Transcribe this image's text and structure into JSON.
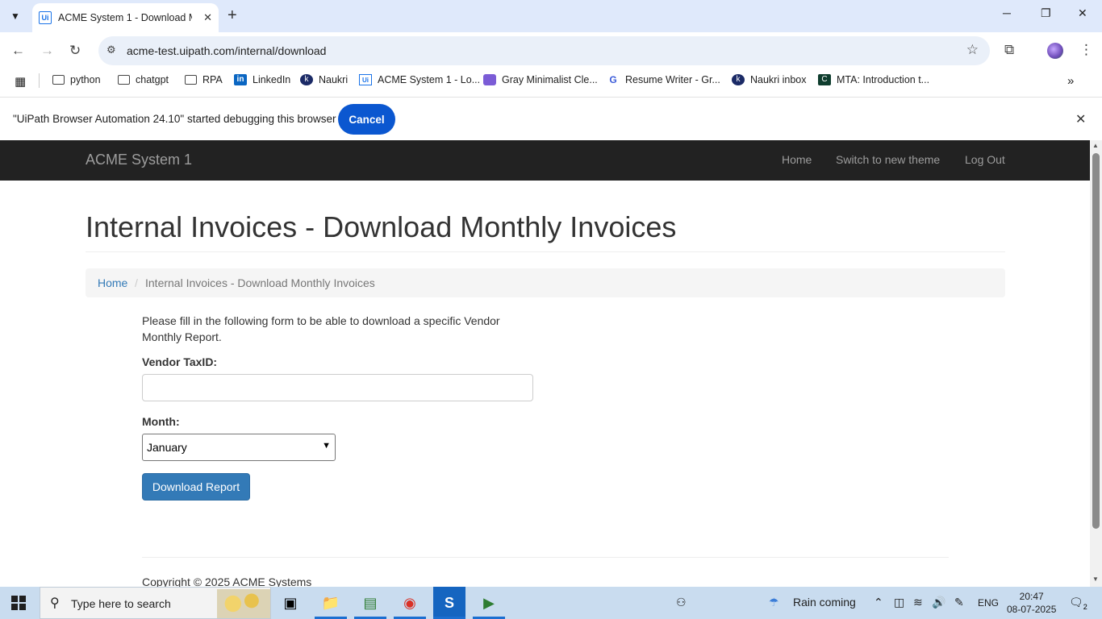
{
  "browser": {
    "tab_title": "ACME System 1 - Download Mo",
    "tab_favicon": "Ui",
    "url": "acme-test.uipath.com/internal/download",
    "bookmarks": [
      {
        "label": "python",
        "icon": "folder-icon"
      },
      {
        "label": "chatgpt",
        "icon": "folder-icon"
      },
      {
        "label": "RPA",
        "icon": "folder-icon"
      },
      {
        "label": "LinkedIn",
        "icon": "linkedin-icon"
      },
      {
        "label": "Naukri",
        "icon": "naukri-icon"
      },
      {
        "label": "ACME System 1 - Lo...",
        "icon": "uipath-icon"
      },
      {
        "label": "Gray Minimalist Cle...",
        "icon": "printer-icon"
      },
      {
        "label": "Resume Writer - Gr...",
        "icon": "g-icon"
      },
      {
        "label": "Naukri inbox",
        "icon": "naukri-icon"
      },
      {
        "label": "MTA: Introduction t...",
        "icon": "course-icon"
      }
    ],
    "infobar_message": "\"UiPath Browser Automation 24.10\" started debugging this browser",
    "infobar_cancel": "Cancel"
  },
  "site": {
    "brand": "ACME System 1",
    "nav": {
      "home": "Home",
      "theme": "Switch to new theme",
      "logout": "Log Out"
    },
    "page_title": "Internal Invoices - Download Monthly Invoices",
    "breadcrumb": {
      "home": "Home",
      "separator": "/",
      "current": "Internal Invoices - Download Monthly Invoices"
    },
    "intro": "Please fill in the following form to be able to download a specific Vendor Monthly Report.",
    "form": {
      "vendor_label": "Vendor TaxID:",
      "vendor_value": "",
      "month_label": "Month:",
      "month_value": "January",
      "submit": "Download Report"
    },
    "copyright": "Copyright © 2025 ACME Systems"
  },
  "taskbar": {
    "search_placeholder": "Type here to search",
    "weather": "Rain coming",
    "language": "ENG",
    "time": "20:47",
    "date": "08-07-2025",
    "notifications": "2"
  },
  "colors": {
    "navbar": "#222222",
    "link": "#337ab7",
    "primary_button": "#337ab7",
    "chrome_cancel": "#0b57d0"
  }
}
